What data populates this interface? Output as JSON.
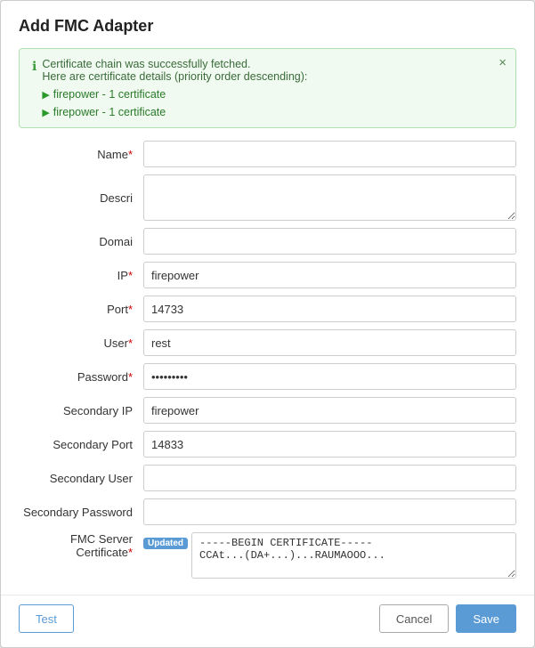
{
  "dialog": {
    "title": "Add FMC Adapter"
  },
  "alert": {
    "line1": "Certificate chain was successfully fetched.",
    "line2": "Here are certificate details (priority order descending):",
    "cert1": "firepower - 1 certificate",
    "cert2": "firepower - 1 certificate",
    "close_label": "×"
  },
  "form": {
    "name_label": "Name",
    "description_label": "Descri",
    "domain_label": "Domai",
    "ip_label": "IP",
    "port_label": "Port",
    "user_label": "User",
    "password_label": "Password",
    "secondary_ip_label": "Secondary IP",
    "secondary_port_label": "Secondary Port",
    "secondary_user_label": "Secondary User",
    "secondary_password_label": "Secondary Password",
    "fmc_cert_label": "FMC Server Certificate",
    "ip_value": "firepower",
    "port_value": "14733",
    "user_value": "rest",
    "password_value": "••••••••",
    "secondary_ip_value": "firepower",
    "secondary_port_value": "14833",
    "secondary_user_value": "",
    "secondary_password_value": "",
    "cert_badge": "Updated",
    "cert_value": "-----BEGIN CERTIFICATE-----\nCCAt...(DA+...)...RAUMAOOO..."
  },
  "footer": {
    "test_label": "Test",
    "cancel_label": "Cancel",
    "save_label": "Save"
  }
}
